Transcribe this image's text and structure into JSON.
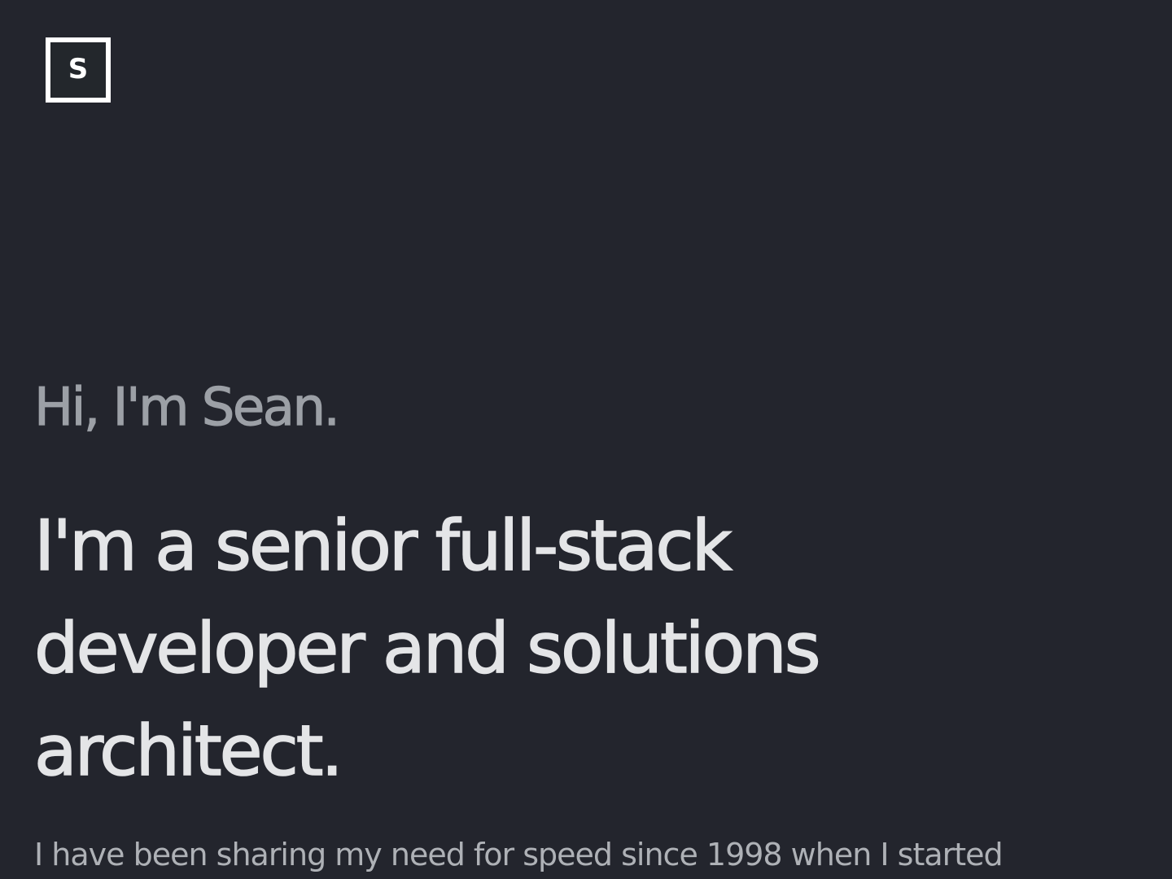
{
  "logo": {
    "letter": "S"
  },
  "hero": {
    "greeting": "Hi, I'm Sean.",
    "headline": "I'm a senior full-stack developer and solutions architect.",
    "intro": "I have been sharing my need for speed since 1998 when I started"
  },
  "colors": {
    "background": "#23252d",
    "greeting_text": "#9ca0a6",
    "headline_text": "#e4e5e7",
    "body_text": "#aeb1b6",
    "logo_border": "#ffffff"
  }
}
